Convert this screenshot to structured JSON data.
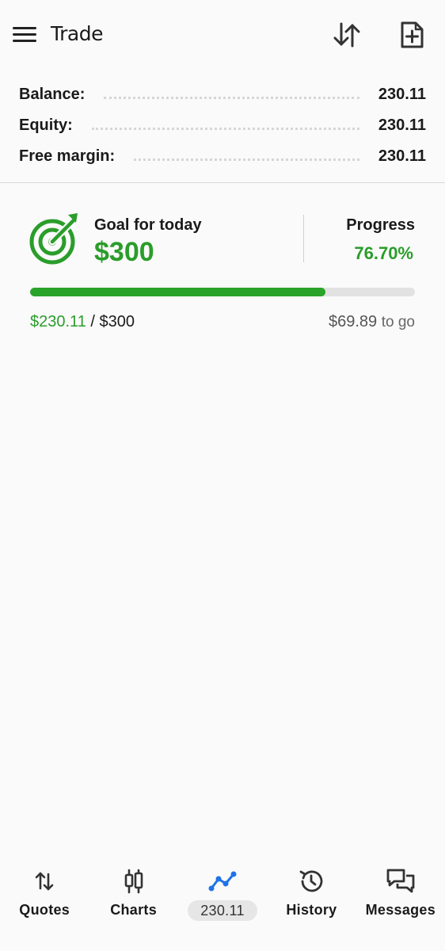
{
  "header": {
    "title": "Trade",
    "menu_icon": "hamburger-menu-icon",
    "sort_icon": "sort-arrows-icon",
    "new_order_icon": "new-order-doc-plus-icon"
  },
  "account": {
    "rows": [
      {
        "label": "Balance:",
        "value": "230.11"
      },
      {
        "label": "Equity:",
        "value": "230.11"
      },
      {
        "label": "Free margin:",
        "value": "230.11"
      }
    ]
  },
  "goal": {
    "label": "Goal for today",
    "amount": "$300",
    "progress_label": "Progress",
    "progress_value": "76.70%",
    "progress_fraction": 0.767,
    "current": "$230.11",
    "separator": " / ",
    "target": "$300",
    "remaining": "$69.89",
    "remaining_suffix": "to go",
    "icon": "target-goal-icon",
    "accent_color": "#2a9d2a"
  },
  "bottom_nav": {
    "items": [
      {
        "label": "Quotes",
        "icon": "quotes-arrows-icon"
      },
      {
        "label": "Charts",
        "icon": "candlestick-chart-icon"
      },
      {
        "label": "230.11",
        "icon": "trade-line-icon",
        "active": true
      },
      {
        "label": "History",
        "icon": "history-clock-icon"
      },
      {
        "label": "Messages",
        "icon": "messages-chat-icon"
      }
    ],
    "active_color": "#1e73e8"
  }
}
